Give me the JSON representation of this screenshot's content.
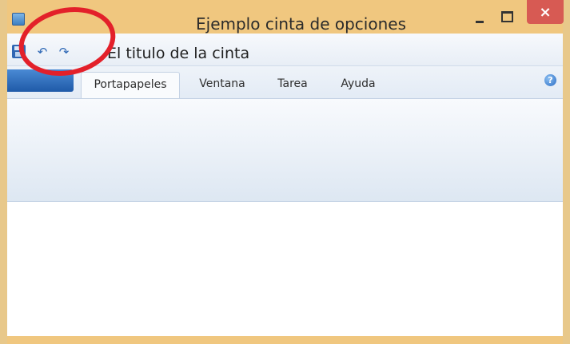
{
  "window": {
    "title": "Ejemplo cinta de opciones",
    "minimize_icon": "minimize-icon",
    "maximize_icon": "maximize-icon",
    "close_label": "×",
    "accent_color": "#f0c77f",
    "close_color": "#d75a53"
  },
  "quick_access": {
    "icons": [
      "save-icon",
      "undo-icon",
      "redo-icon"
    ],
    "undo_glyph": "↶",
    "redo_glyph": "↷",
    "ribbon_title": "El titulo de la cinta"
  },
  "ribbon": {
    "tabs": [
      {
        "label": "Portapapeles",
        "active": true
      },
      {
        "label": "Ventana",
        "active": false
      },
      {
        "label": "Tarea",
        "active": false
      },
      {
        "label": "Ayuda",
        "active": false
      }
    ],
    "help_glyph": "?"
  },
  "annotation": {
    "color": "#e3202a",
    "shape": "ellipse"
  }
}
